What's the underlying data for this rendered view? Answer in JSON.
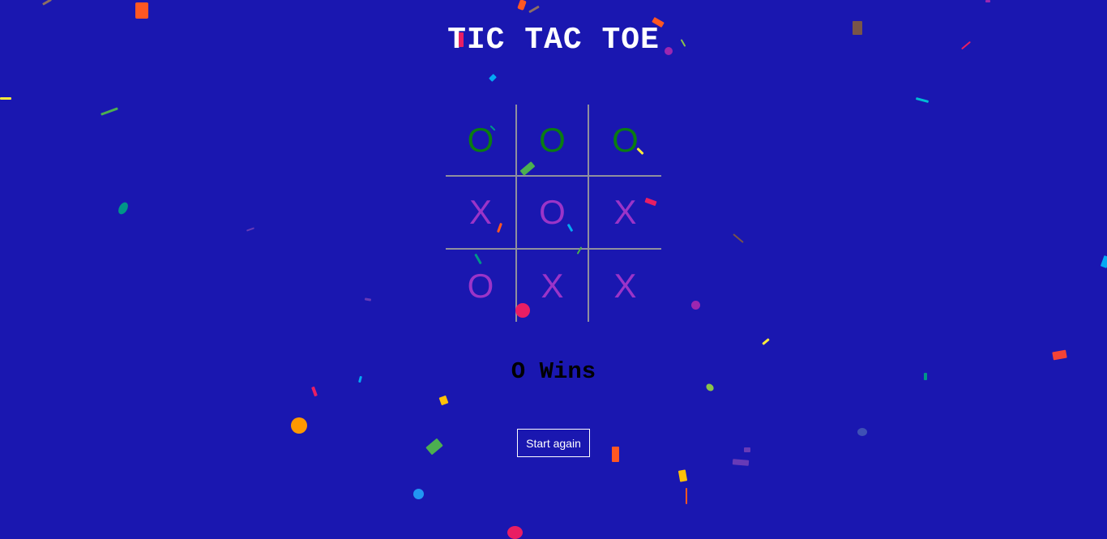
{
  "game": {
    "title": "TIC TAC TOE",
    "board": [
      [
        "O",
        "O",
        "O"
      ],
      [
        "X",
        "O",
        "X"
      ],
      [
        "O",
        "X",
        "X"
      ]
    ],
    "winning_line": [
      [
        0,
        0
      ],
      [
        0,
        1
      ],
      [
        0,
        2
      ]
    ],
    "status_text": "O Wins",
    "restart_label": "Start again"
  },
  "colors": {
    "background": "#1a17b0",
    "mark": "#9b34c8",
    "winning_mark": "#0a7c12",
    "grid_line": "#8f8f9e",
    "title": "#ffffff",
    "status": "#000000"
  }
}
